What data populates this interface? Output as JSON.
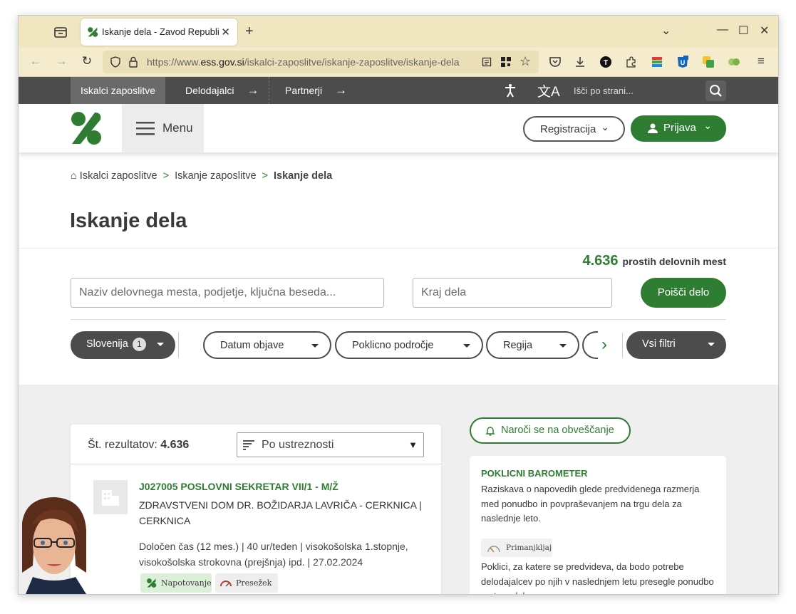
{
  "browser": {
    "tab_title": "Iskanje dela - Zavod Republike",
    "url_prefix": "https://www.",
    "url_domain": "ess.gov.si",
    "url_path": "/iskalci-zaposlitve/iskanje-zaposlitve/iskanje-dela"
  },
  "topnav": {
    "items": [
      {
        "label": "Iskalci zaposlitve"
      },
      {
        "label": "Delodajalci"
      },
      {
        "label": "Partnerji"
      }
    ],
    "search_placeholder": "Išči po strani..."
  },
  "header": {
    "menu_label": "Menu",
    "register_label": "Registracija",
    "login_label": "Prijava",
    "brand_color": "#2e7d32"
  },
  "breadcrumb": {
    "home": "Iskalci zaposlitve",
    "level2": "Iskanje zaposlitve",
    "current": "Iskanje dela"
  },
  "page_title": "Iskanje dela",
  "search": {
    "count": "4.636",
    "count_label": "prostih delovnih mest",
    "keyword_placeholder": "Naziv delovnega mesta, podjetje, ključna beseda...",
    "location_placeholder": "Kraj dela",
    "button_label": "Poišči delo"
  },
  "filters": {
    "country": "Slovenija",
    "country_count": "1",
    "date": "Datum objave",
    "field": "Poklicno področje",
    "region": "Regija",
    "all": "Vsi filtri"
  },
  "results": {
    "count_label": "Št. rezultatov:",
    "count": "4.636",
    "sort": "Po ustreznosti",
    "job": {
      "title": "J027005 POSLOVNI SEKRETAR VII/1 - M/Ž",
      "company": "ZDRAVSTVENI DOM DR. BOŽIDARJA LAVRIČA - CERKNICA | CERKNICA",
      "details": "Določen čas (12 mes.) | 40 ur/teden | visokošolska 1.stopnje, visokošolska strokovna (prejšnja) ipd. | 27.02.2024",
      "tag1": "Napotovanje",
      "tag2": "Presežek"
    }
  },
  "sidebar": {
    "notify": "Naroči se na obveščanje",
    "barometer_title": "POKLICNI BAROMETER",
    "barometer_text": "Raziskava o napovedih glede predvidenega razmerja med ponudbo in povpraševanjem na trgu dela za naslednje leto.",
    "deficit_label": "Primanjkljaj",
    "deficit_text": "Poklici, za katere se predvideva, da bodo potrebe delodajalcev po njih v naslednjem letu presegle ponudbo na trgu dela."
  }
}
